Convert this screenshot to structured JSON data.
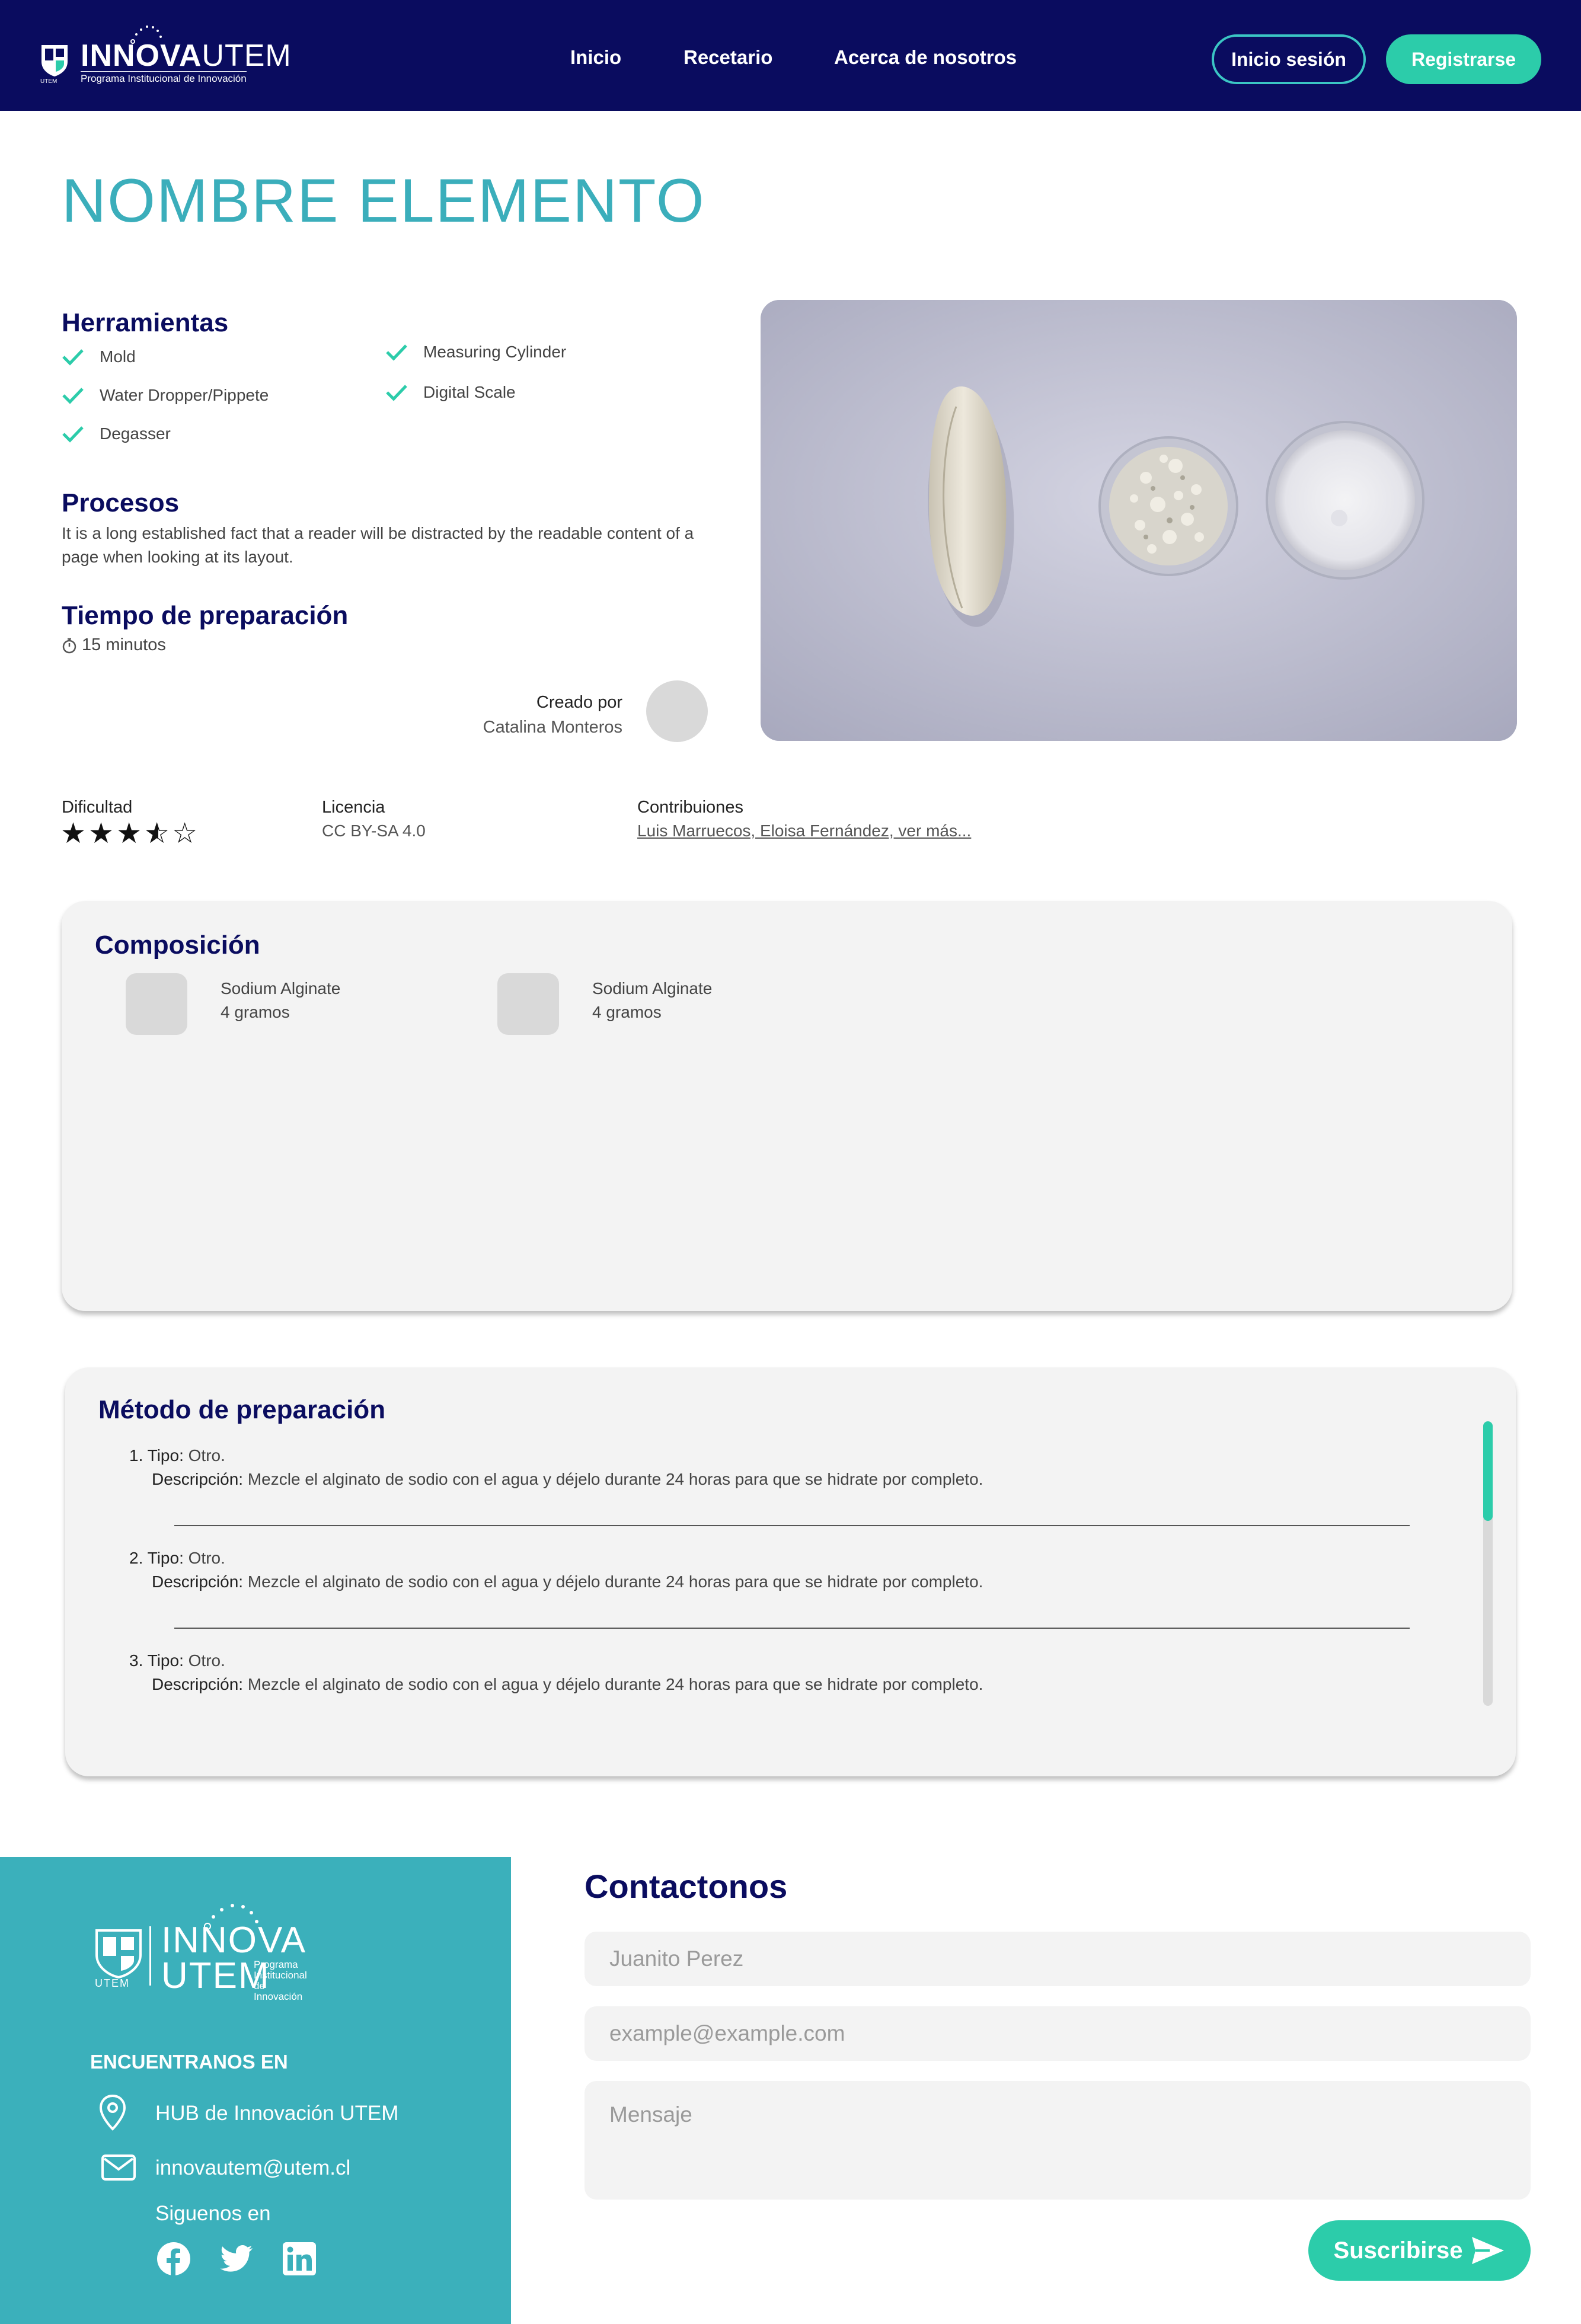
{
  "nav": {
    "brand_bold": "INNOVA",
    "brand_light": "UTEM",
    "brand_sub": "Programa Institucional de Innovación",
    "brand_utem": "UTEM",
    "links": [
      "Inicio",
      "Recetario",
      "Acerca de nosotros"
    ],
    "login": "Inicio sesión",
    "register": "Registrarse"
  },
  "page": {
    "title": "NOMBRE ELEMENTO"
  },
  "tools": {
    "title": "Herramientas",
    "items": [
      "Mold",
      "Water Dropper/Pippete",
      "Degasser",
      "Measuring Cylinder",
      "Digital Scale"
    ]
  },
  "processes": {
    "title": "Procesos",
    "text": "It is a long established fact that a reader will be distracted by the readable content of a page when looking at its layout."
  },
  "prep_time": {
    "title": "Tiempo de preparación",
    "value": "15 minutos"
  },
  "creator": {
    "label": "Creado por",
    "name": "Catalina Monteros"
  },
  "meta": {
    "difficulty_label": "Dificultad",
    "difficulty_rating": 3.5,
    "difficulty_max": 5,
    "license_label": "Licencia",
    "license_value": "CC BY-SA 4.0",
    "contrib_label": "Contribuiones",
    "contrib_value": "Luis Marruecos, Eloisa Fernández, ver más..."
  },
  "composition": {
    "title": "Composición",
    "items": [
      {
        "name": "Sodium Alginate",
        "amount": "4 gramos"
      },
      {
        "name": "Sodium Alginate",
        "amount": "4 gramos"
      }
    ]
  },
  "method": {
    "title": "Método de preparación",
    "type_label": "Tipo:",
    "desc_label": "Descripción:",
    "steps": [
      {
        "n": "1.",
        "type": "Otro.",
        "desc": "Mezcle el alginato de sodio con el agua y déjelo durante 24 horas para que se hidrate por completo."
      },
      {
        "n": "2.",
        "type": "Otro.",
        "desc": "Mezcle el alginato de sodio con el agua y déjelo durante 24 horas para que se hidrate por completo."
      },
      {
        "n": "3.",
        "type": "Otro.",
        "desc": "Mezcle el alginato de sodio con el agua y déjelo durante 24 horas para que se hidrate por completo."
      }
    ]
  },
  "footer": {
    "brand_top": "INNOVA",
    "brand_bottom": "UTEM",
    "brand_sub": "Programa Institucional de Innovación",
    "brand_utem": "UTEM",
    "find_title": "ENCUENTRANOS EN",
    "location": "HUB de Innovación UTEM",
    "email": "innovautem@utem.cl",
    "follow": "Siguenos en",
    "social_icons": [
      "facebook-icon",
      "twitter-icon",
      "linkedin-icon"
    ]
  },
  "contact": {
    "title": "Contactonos",
    "name_placeholder": "Juanito Perez",
    "email_placeholder": "example@example.com",
    "message_placeholder": "Mensaje",
    "submit": "Suscribirse"
  },
  "colors": {
    "navy": "#0a0c5f",
    "teal": "#3bb0bb",
    "accent_green": "#2cccaa",
    "card_bg": "#f3f3f3"
  }
}
